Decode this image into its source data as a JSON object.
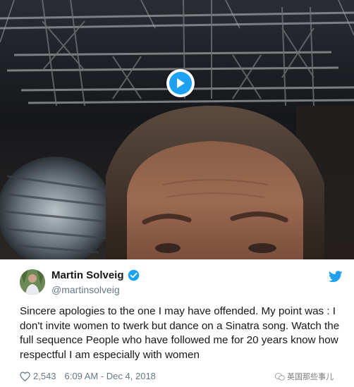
{
  "tweet": {
    "display_name": "Martin Solveig",
    "handle": "@martinsolveig",
    "text": "Sincere apologies to the one I may have offended. My point was : I don't invite women to twerk but dance on a Sinatra song. Watch the full sequence People who have followed me for 20 years know how respectful I am especially with women",
    "likes": "2,543",
    "timestamp": "6:09 AM - Dec 4, 2018"
  },
  "video": {
    "play_icon": "play-icon"
  },
  "watermark": {
    "text": "英国那些事儿"
  },
  "colors": {
    "twitter_blue": "#1da1f2",
    "secondary_text": "#657786",
    "primary_text": "#14171a"
  }
}
